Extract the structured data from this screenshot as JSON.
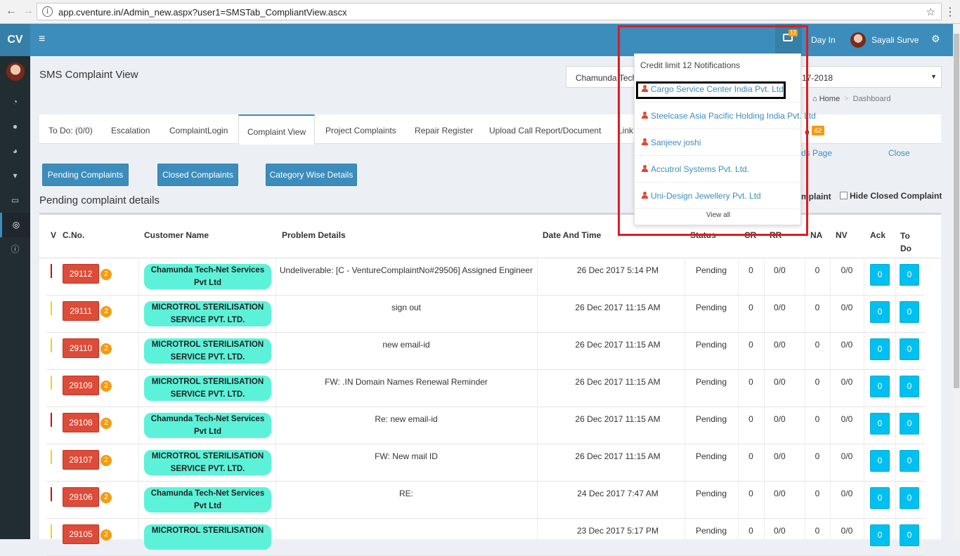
{
  "browser": {
    "url": "app.cventure.in/Admin_new.aspx?user1=SMSTab_CompliantView.ascx",
    "back": "←",
    "forward": "→",
    "reload": "C",
    "info": "i",
    "bookmark": "☆",
    "menu": "⋮"
  },
  "header": {
    "logo": "CV",
    "hamburger": "≡",
    "notif_badge": "12",
    "day_in": "Day In",
    "user_name": "Sayali Surve",
    "settings": "⚙"
  },
  "sidebar": {
    "icons": [
      {
        "name": "dashboard-icon",
        "glyph": "◔"
      },
      {
        "name": "user-icon",
        "glyph": "●"
      },
      {
        "name": "pie-chart-icon",
        "glyph": "◕"
      },
      {
        "name": "cart-icon",
        "glyph": "▾"
      },
      {
        "name": "card-icon",
        "glyph": "▭"
      },
      {
        "name": "support-icon",
        "glyph": "◎"
      },
      {
        "name": "info-icon",
        "glyph": "ⓘ"
      }
    ]
  },
  "page": {
    "title": "SMS Complaint View",
    "company_select": "Chamunda Tech-",
    "year_select": "17-2018",
    "caret": "▼",
    "breadcrumb_home": "Home",
    "breadcrumb_sep": ">",
    "breadcrumb_current": "Dashboard",
    "breadcrumb_icon": "⌂"
  },
  "tabs": [
    {
      "label": "To Do: (0/0)"
    },
    {
      "label": "Escalation"
    },
    {
      "label": "ComplaintLogin"
    },
    {
      "label": "Complaint View"
    },
    {
      "label": "Project Complaints"
    },
    {
      "label": "Repair Register"
    },
    {
      "label": "Upload Call Report/Document"
    },
    {
      "label": "Link"
    }
  ],
  "tab_fragment": "o",
  "todo_badge": "62",
  "links": {
    "page_frag": "ds Page",
    "close": "Close"
  },
  "buttons": {
    "pending": "Pending Complaints",
    "closed": "Closed Complaints",
    "category": "Category Wise Details"
  },
  "section_title": "Pending complaint details",
  "filters": {
    "frag": "mplaint",
    "hide_closed": "Hide Closed Complaint"
  },
  "table": {
    "headers": {
      "v": "V",
      "cno": "C.No.",
      "customer": "Customer Name",
      "problem": "Problem Details",
      "datetime": "Date And Time",
      "status": "Status",
      "cr": "CR",
      "rr": "RR",
      "na": "NA",
      "nv": "NV",
      "ack": "Ack",
      "todo": "To Do"
    },
    "rows": [
      {
        "flag": "#e00000",
        "cno": "29112",
        "count": "2",
        "customer": "Chamunda Tech-Net Services Pvt Ltd",
        "problem": "Undeliverable: [C - VentureComplaintNo#29506] Assigned Engineer",
        "datetime": "26 Dec 2017 5:14 PM",
        "status": "Pending",
        "cr": "0",
        "rr": "0/0",
        "na": "0",
        "nv": "0/0",
        "ack": "0",
        "todo": "0"
      },
      {
        "flag": "#f2d600",
        "cno": "29111",
        "count": "2",
        "customer": "MICROTROL STERILISATION SERVICE PVT. LTD.",
        "problem": "sign out",
        "datetime": "26 Dec 2017 11:15 AM",
        "status": "Pending",
        "cr": "0",
        "rr": "0/0",
        "na": "0",
        "nv": "0/0",
        "ack": "0",
        "todo": "0"
      },
      {
        "flag": "#f2d600",
        "cno": "29110",
        "count": "2",
        "customer": "MICROTROL STERILISATION SERVICE PVT. LTD.",
        "problem": "new email-id",
        "datetime": "26 Dec 2017 11:15 AM",
        "status": "Pending",
        "cr": "0",
        "rr": "0/0",
        "na": "0",
        "nv": "0/0",
        "ack": "0",
        "todo": "0"
      },
      {
        "flag": "#f2d600",
        "cno": "29109",
        "count": "2",
        "customer": "MICROTROL STERILISATION SERVICE PVT. LTD.",
        "problem": "FW: .IN Domain Names Renewal Reminder",
        "datetime": "26 Dec 2017 11:15 AM",
        "status": "Pending",
        "cr": "0",
        "rr": "0/0",
        "na": "0",
        "nv": "0/0",
        "ack": "0",
        "todo": "0"
      },
      {
        "flag": "#e00000",
        "cno": "29108",
        "count": "2",
        "customer": "Chamunda Tech-Net Services Pvt Ltd",
        "problem": "Re: new email-id",
        "datetime": "26 Dec 2017 11:15 AM",
        "status": "Pending",
        "cr": "0",
        "rr": "0/0",
        "na": "0",
        "nv": "0/0",
        "ack": "0",
        "todo": "0"
      },
      {
        "flag": "#f2d600",
        "cno": "29107",
        "count": "2",
        "customer": "MICROTROL STERILISATION SERVICE PVT. LTD.",
        "problem": "FW: New mail ID",
        "datetime": "26 Dec 2017 11:15 AM",
        "status": "Pending",
        "cr": "0",
        "rr": "0/0",
        "na": "0",
        "nv": "0/0",
        "ack": "0",
        "todo": "0"
      },
      {
        "flag": "#e00000",
        "cno": "29106",
        "count": "2",
        "customer": "Chamunda Tech-Net Services Pvt Ltd",
        "problem": "RE:",
        "datetime": "24 Dec 2017 7:47 AM",
        "status": "Pending",
        "cr": "0",
        "rr": "0/0",
        "na": "0",
        "nv": "0/0",
        "ack": "0",
        "todo": "0"
      },
      {
        "flag": "#f2d600",
        "cno": "29105",
        "count": "2",
        "customer": "MICROTROL STERILISATION",
        "problem": "",
        "datetime": "23 Dec 2017 5:17 PM",
        "status": "Pending",
        "cr": "0",
        "rr": "0/0",
        "na": "0",
        "nv": "0/0",
        "ack": "0",
        "todo": "0"
      }
    ]
  },
  "notifications": {
    "header": "Credit limit 12 Notifications",
    "items": [
      "Cargo Service Center India Pvt. Ltd.",
      "Steelcase Asia Pacific Holding India Pvt. Ltd",
      "Sanjeev joshi",
      "Accutrol Systems Pvt. Ltd.",
      "Uni-Design Jewellery Pvt. Ltd"
    ],
    "view_all": "View all"
  },
  "colors": {
    "header": "#3c8dbc",
    "sidebar": "#222d32",
    "complaint_number": "#dd4b39",
    "count_badge": "#f39c12",
    "customer_pill": "#5cf2d9",
    "action_button": "#00c0ef",
    "annotation_red": "#e01a22",
    "annotation_black": "#000000"
  }
}
